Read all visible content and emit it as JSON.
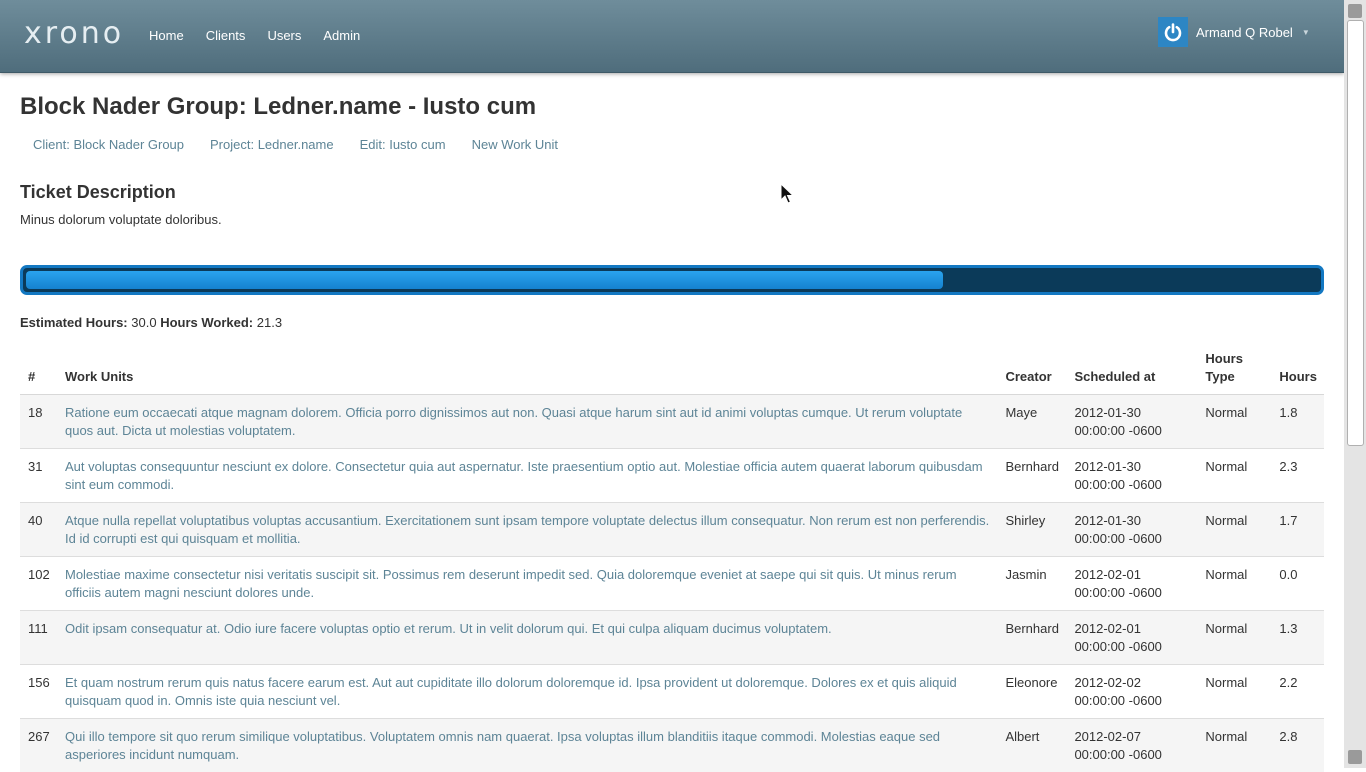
{
  "nav": {
    "brand": "xrono",
    "links": [
      "Home",
      "Clients",
      "Users",
      "Admin"
    ],
    "user_name": "Armand Q Robel",
    "user_icon": "power-icon"
  },
  "page": {
    "title": "Block Nader Group: Ledner.name - Iusto cum",
    "subnav": [
      "Client: Block Nader Group",
      "Project: Ledner.name",
      "Edit: Iusto cum",
      "New Work Unit"
    ],
    "section_title": "Ticket Description",
    "description": "Minus dolorum voluptate doloribus."
  },
  "progress": {
    "fraction": 0.71
  },
  "hours": {
    "estimated_label": "Estimated Hours:",
    "estimated_value": "30.0",
    "worked_label": "Hours Worked:",
    "worked_value": "21.3"
  },
  "table": {
    "headers": [
      "#",
      "Work Units",
      "Creator",
      "Scheduled at",
      "Hours Type",
      "Hours"
    ],
    "rows": [
      {
        "id": "18",
        "description": "Ratione eum occaecati atque magnam dolorem. Officia porro dignissimos aut non. Quasi atque harum sint aut id animi voluptas cumque. Ut rerum voluptate quos aut. Dicta ut molestias voluptatem.",
        "creator": "Maye",
        "scheduled": "2012-01-30 00:00:00 -0600",
        "type": "Normal",
        "hours": "1.8"
      },
      {
        "id": "31",
        "description": "Aut voluptas consequuntur nesciunt ex dolore. Consectetur quia aut aspernatur. Iste praesentium optio aut. Molestiae officia autem quaerat laborum quibusdam sint eum commodi.",
        "creator": "Bernhard",
        "scheduled": "2012-01-30 00:00:00 -0600",
        "type": "Normal",
        "hours": "2.3"
      },
      {
        "id": "40",
        "description": "Atque nulla repellat voluptatibus voluptas accusantium. Exercitationem sunt ipsam tempore voluptate delectus illum consequatur. Non rerum est non perferendis. Id id corrupti est qui quisquam et mollitia.",
        "creator": "Shirley",
        "scheduled": "2012-01-30 00:00:00 -0600",
        "type": "Normal",
        "hours": "1.7"
      },
      {
        "id": "102",
        "description": "Molestiae maxime consectetur nisi veritatis suscipit sit. Possimus rem deserunt impedit sed. Quia doloremque eveniet at saepe qui sit quis. Ut minus rerum officiis autem magni nesciunt dolores unde.",
        "creator": "Jasmin",
        "scheduled": "2012-02-01 00:00:00 -0600",
        "type": "Normal",
        "hours": "0.0"
      },
      {
        "id": "111",
        "description": "Odit ipsam consequatur at. Odio iure facere voluptas optio et rerum. Ut in velit dolorum qui. Et qui culpa aliquam ducimus voluptatem.",
        "creator": "Bernhard",
        "scheduled": "2012-02-01 00:00:00 -0600",
        "type": "Normal",
        "hours": "1.3"
      },
      {
        "id": "156",
        "description": "Et quam nostrum rerum quis natus facere earum est. Aut aut cupiditate illo dolorum doloremque id. Ipsa provident ut doloremque. Dolores ex et quis aliquid quisquam quod in. Omnis iste quia nesciunt vel.",
        "creator": "Eleonore",
        "scheduled": "2012-02-02 00:00:00 -0600",
        "type": "Normal",
        "hours": "2.2"
      },
      {
        "id": "267",
        "description": "Qui illo tempore sit quo rerum similique voluptatibus. Voluptatem omnis nam quaerat. Ipsa voluptas illum blanditiis itaque commodi. Molestias eaque sed asperiores incidunt numquam.",
        "creator": "Albert",
        "scheduled": "2012-02-07 00:00:00 -0600",
        "type": "Normal",
        "hours": "2.8"
      }
    ]
  }
}
